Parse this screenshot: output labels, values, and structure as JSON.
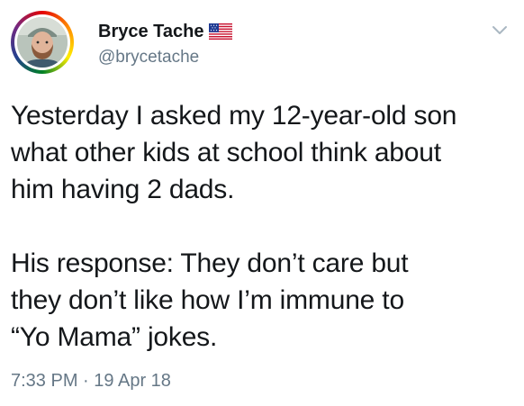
{
  "tweet": {
    "author": {
      "display_name": "Bryce Tache",
      "handle": "@brycetache",
      "flag_icon": "us-flag-icon",
      "avatar_ring_style": "rainbow"
    },
    "menu_icon": "chevron-down-icon",
    "body_lines": [
      "Yesterday I asked my 12-year-old son",
      "what other kids at school think about",
      "him having 2 dads."
    ],
    "body_lines_2": [
      "His response: They don’t care but",
      "they don’t like how I’m immune to",
      "“Yo Mama” jokes."
    ],
    "time": "7:33 PM",
    "separator": "·",
    "date": "19 Apr 18"
  },
  "colors": {
    "text_primary": "#14171a",
    "text_secondary": "#657786",
    "background": "#ffffff"
  }
}
